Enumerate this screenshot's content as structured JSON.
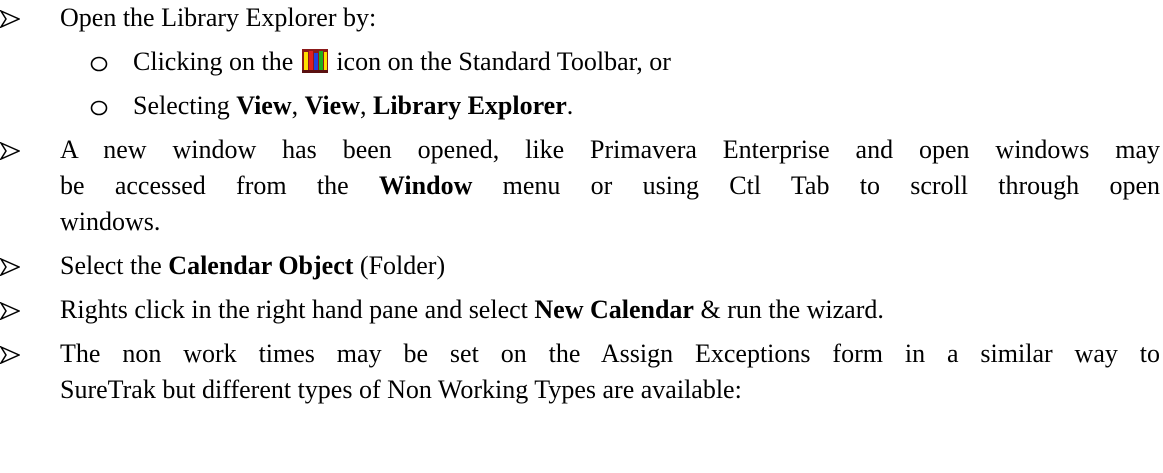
{
  "items": [
    {
      "text": "Open the Library Explorer by:"
    },
    {
      "sub": [
        {
          "before": "Clicking on the",
          "after": "icon on the Standard Toolbar, or"
        },
        {
          "pre": "Selecting ",
          "b1": "View",
          "sep1": ", ",
          "b2": "View",
          "sep2": ", ",
          "b3": "Library Explorer",
          "post": "."
        }
      ]
    },
    {
      "line1_pre": "A new window has been opened, like Primavera Enterprise and open windows may",
      "line2_pre": "be accessed from the ",
      "line2_bold": "Window",
      "line2_post": " menu or using Ctl Tab to scroll through open",
      "line3": "windows."
    },
    {
      "pre": "Select the ",
      "bold": "Calendar Object",
      "post": " (Folder)"
    },
    {
      "pre": "Rights click in the right hand pane and select ",
      "bold": "New Calendar",
      "post": " & run the wizard."
    },
    {
      "line1": "The non work times may be set on the Assign Exceptions form in a similar way to",
      "line2": "SureTrak but different types of Non Working Types are available:"
    }
  ],
  "icons": {
    "bullet": "arrowhead-bullet-icon",
    "sub_bullet": "circle-bullet-icon",
    "library": "library-books-icon"
  }
}
